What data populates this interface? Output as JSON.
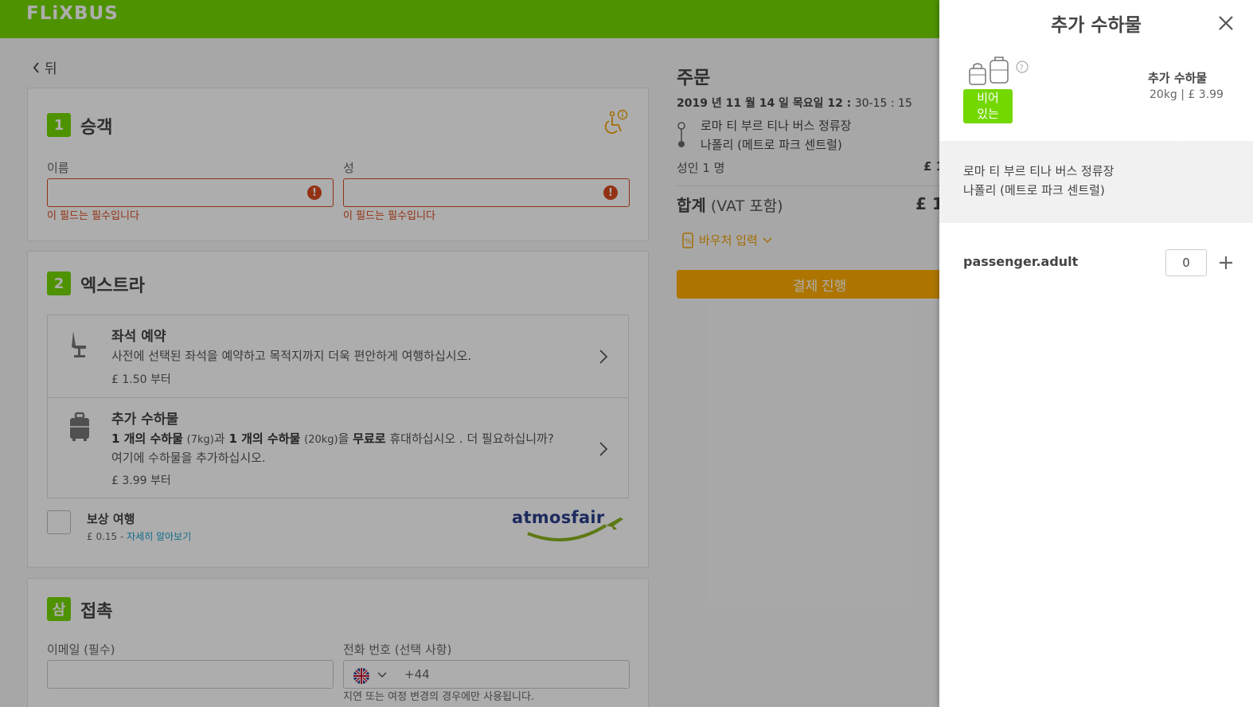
{
  "header": {
    "logo": "FLiXBUS",
    "brand_color": "#73d700"
  },
  "back_label": "뒤",
  "passengers": {
    "step": "1",
    "title": "승객",
    "first_name_label": "이름",
    "last_name_label": "성",
    "error": "이 필드는 필수입니다",
    "error_icon": "!"
  },
  "extras": {
    "step": "2",
    "title": "엑스트라",
    "seat": {
      "title": "좌석 예약",
      "desc": "사전에 선택된 좌석을 예약하고 목적지까지 더욱 편안하게 여행하십시오.",
      "price": "£ 1.50 부터"
    },
    "luggage": {
      "title": "추가 수하물",
      "qty1": "1 개의 수하물",
      "w1": "(7kg)",
      "and": "과 ",
      "qty2": "1 개의 수하물",
      "w2": "(20kg)",
      "mid": "을 ",
      "free": "무료로",
      "rest": " 휴대하십시오 . 더 필요하십니까?",
      "line2": "여기에 수하물을 추가하십시오.",
      "price": "£ 3.99 부터"
    },
    "compensation": {
      "title": "보상 여행",
      "price": "£ 0.15 - ",
      "link": "자세히 알아보기",
      "partner": "atmosfair"
    }
  },
  "contact": {
    "step": "삼",
    "title": "접촉",
    "email_label": "이메일 (필수)",
    "phone_label": "전화 번호 (선택 사항)",
    "phone_code": "+44",
    "phone_note": "지연 또는 여정 변경의 경우에만 사용됩니다."
  },
  "order": {
    "title": "주문",
    "date_bold": "2019 년 11 월 14 일 목요일 12 :",
    "date_rest": " 30-15 : 15",
    "from": "로마 티 부르 티나 버스 정류장",
    "to": "나폴리 (메트로 파크 센트럴)",
    "passengers": "성인 1 명",
    "pax_price": "£ 1",
    "total_label": "합계",
    "total_vat": " (VAT 포함)",
    "total_price": "£ 1(",
    "voucher": "바우처 입력",
    "checkout": "결제 진행",
    "checkout_color": "#ffad00"
  },
  "drawer": {
    "title": "추가 수하물",
    "empty_line1": "비어",
    "empty_line2": "있는",
    "bag_title": "추가 수하물",
    "bag_price": "20kg | £ 3.99",
    "from": "로마 티 부르 티나 버스 정류장",
    "to": "나폴리 (메트로 파크 센트럴)",
    "passenger_label": "passenger.adult",
    "quantity": "0"
  }
}
